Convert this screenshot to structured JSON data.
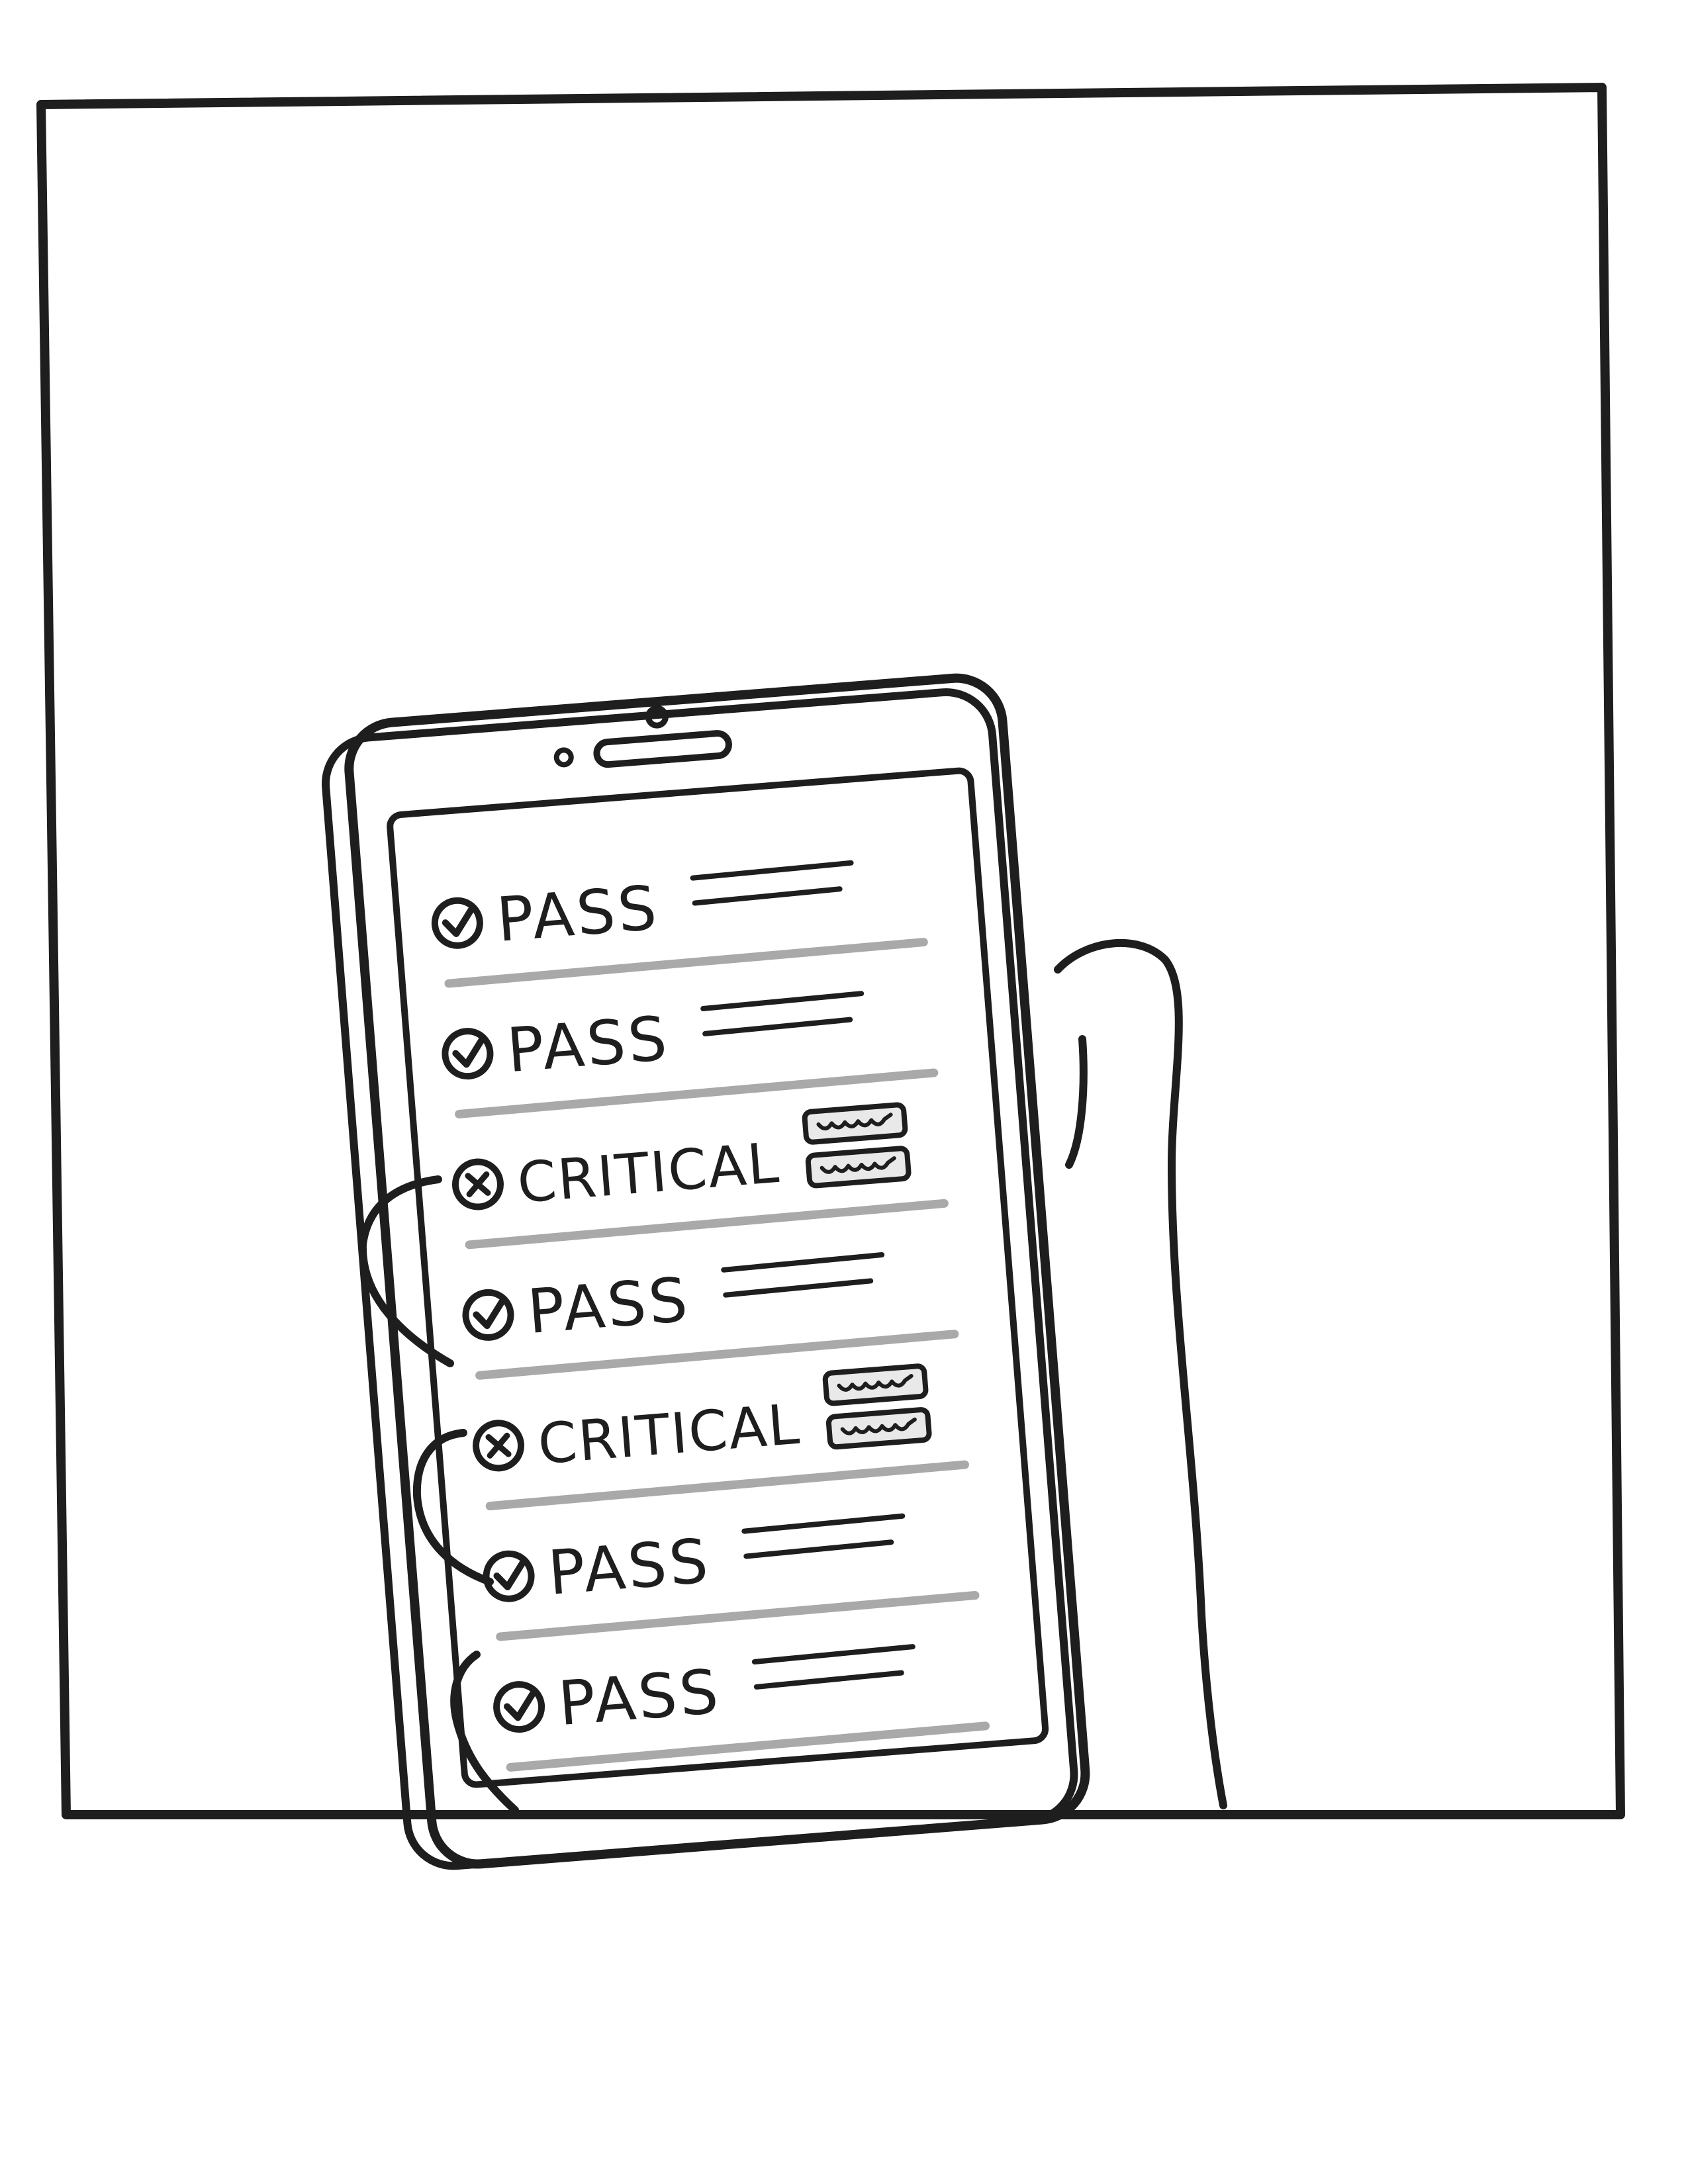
{
  "screen": {
    "rows": [
      {
        "status": "pass",
        "label": "PASS",
        "icon": "check-circle-icon",
        "detail": "text-lines"
      },
      {
        "status": "pass",
        "label": "PASS",
        "icon": "check-circle-icon",
        "detail": "text-lines"
      },
      {
        "status": "critical",
        "label": "CRITICAL",
        "icon": "x-circle-icon",
        "detail": "action-buttons"
      },
      {
        "status": "pass",
        "label": "PASS",
        "icon": "check-circle-icon",
        "detail": "text-lines"
      },
      {
        "status": "critical",
        "label": "CRITICAL",
        "icon": "x-circle-icon",
        "detail": "action-buttons"
      },
      {
        "status": "pass",
        "label": "PASS",
        "icon": "check-circle-icon",
        "detail": "text-lines"
      },
      {
        "status": "pass",
        "label": "PASS",
        "icon": "check-circle-icon",
        "detail": "text-lines"
      }
    ]
  },
  "style": {
    "ink": "#1e1e1e",
    "divider": "#a9a9a9",
    "pill_fill": "#e9e9e9",
    "background": "#ffffff"
  }
}
